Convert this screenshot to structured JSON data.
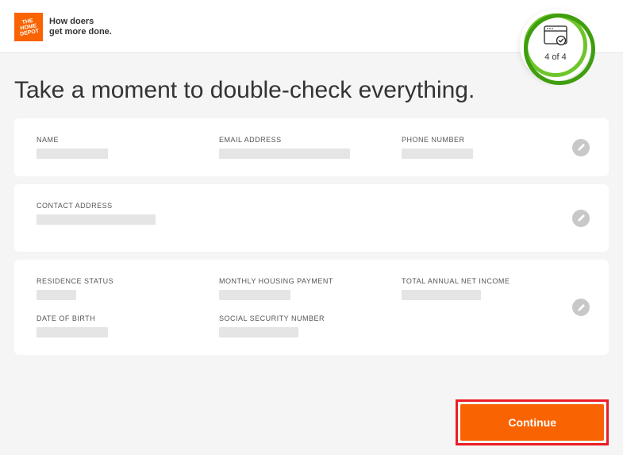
{
  "header": {
    "tagline_line1": "How doers",
    "tagline_line2": "get more done.",
    "logo_text": "THE HOME DEPOT"
  },
  "progress": {
    "label": "4 of 4"
  },
  "page": {
    "title": "Take a moment to double-check everything."
  },
  "cards": [
    {
      "fields": [
        {
          "label": "NAME"
        },
        {
          "label": "EMAIL ADDRESS"
        },
        {
          "label": "PHONE NUMBER"
        }
      ]
    },
    {
      "fields": [
        {
          "label": "CONTACT ADDRESS"
        }
      ]
    },
    {
      "fields": [
        {
          "label": "RESIDENCE STATUS"
        },
        {
          "label": "MONTHLY HOUSING PAYMENT"
        },
        {
          "label": "TOTAL ANNUAL NET INCOME"
        },
        {
          "label": "DATE OF BIRTH"
        },
        {
          "label": "SOCIAL SECURITY NUMBER"
        }
      ]
    }
  ],
  "actions": {
    "continue_label": "Continue"
  }
}
